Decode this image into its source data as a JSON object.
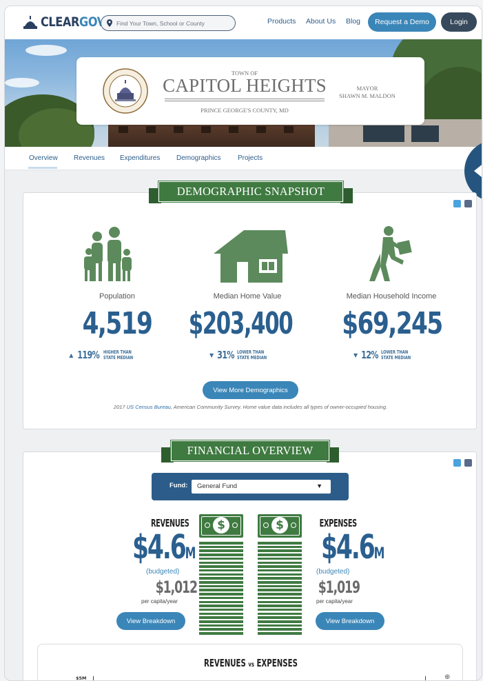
{
  "header": {
    "logo_part1": "CLEAR",
    "logo_part2": "GOV",
    "search_placeholder": "Find Your Town, School or County",
    "nav": [
      "Products",
      "About Us",
      "Blog"
    ],
    "request_demo": "Request a Demo",
    "login": "Login"
  },
  "hero": {
    "town_of": "TOWN OF",
    "town_name": "CAPITOL HEIGHTS",
    "county": "PRINCE GEORGE'S COUNTY, MD",
    "mayor_title": "MAYOR",
    "mayor_name": "SHAWN M. MALDON",
    "seal_text_top": "TOWN OF CAPITOL HEIGHTS, MD",
    "seal_text_bottom": "OFFICIAL SEAL"
  },
  "tabs": [
    "Overview",
    "Revenues",
    "Expenditures",
    "Demographics",
    "Projects"
  ],
  "demographics": {
    "banner": "DEMOGRAPHIC SNAPSHOT",
    "stats": [
      {
        "label": "Population",
        "value": "4,519",
        "direction": "up",
        "pct": "119%",
        "note_line1": "HIGHER THAN",
        "note_line2": "STATE MEDIAN"
      },
      {
        "label": "Median Home Value",
        "value": "$203,400",
        "direction": "down",
        "pct": "31%",
        "note_line1": "LOWER THAN",
        "note_line2": "STATE MEDIAN"
      },
      {
        "label": "Median Household Income",
        "value": "$69,245",
        "direction": "down",
        "pct": "12%",
        "note_line1": "LOWER THAN",
        "note_line2": "STATE MEDIAN"
      }
    ],
    "button": "View More Demographics",
    "source_year": "2017 ",
    "source_link": "US Census Bureau",
    "source_rest": ", American Community Survey. Home value data includes all types of owner-occupied housing."
  },
  "financial": {
    "banner": "FINANCIAL OVERVIEW",
    "fund_label": "Fund:",
    "fund_value": "General Fund",
    "revenues": {
      "title": "REVENUES",
      "amount": "$4.6",
      "unit": "M",
      "budgeted": "(budgeted)",
      "per_capita": "$1,012",
      "per_capita_label": "per capita/year",
      "button": "View Breakdown"
    },
    "expenses": {
      "title": "EXPENSES",
      "amount": "$4.6",
      "unit": "M",
      "budgeted": "(budgeted)",
      "per_capita": "$1,019",
      "per_capita_label": "per capita/year",
      "button": "View Breakdown"
    },
    "chart_title_a": "REVENUES",
    "chart_title_vs": "vs",
    "chart_title_b": "EXPENSES",
    "chart_y_tick": "$5M"
  },
  "colors": {
    "brand_blue": "#3b86b8",
    "navy": "#2a5f8f",
    "green": "#3f7a41",
    "dark_button": "#37495c"
  }
}
